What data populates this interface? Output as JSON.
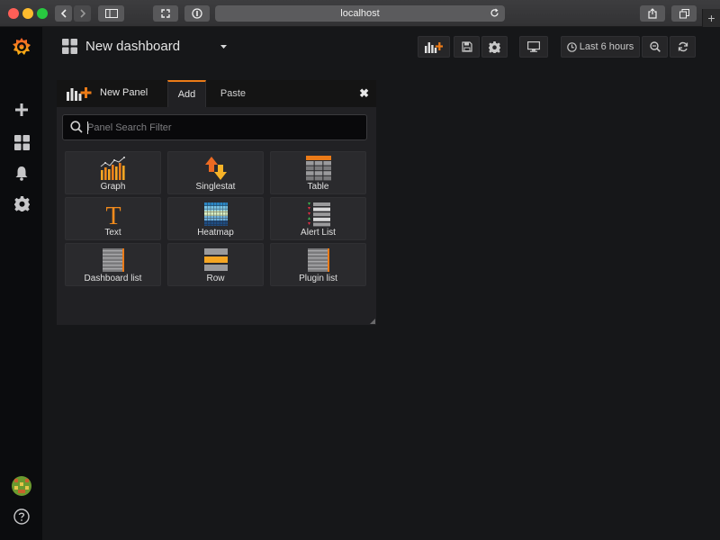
{
  "browser": {
    "url": "localhost"
  },
  "topnav": {
    "dashboard_title": "New dashboard",
    "time_range": "Last 6 hours"
  },
  "panel": {
    "title": "New Panel",
    "tabs": [
      {
        "label": "Add",
        "active": true
      },
      {
        "label": "Paste",
        "active": false
      }
    ],
    "search": {
      "placeholder": "Panel Search Filter",
      "value": ""
    },
    "items": [
      {
        "label": "Graph",
        "icon": "graph-icon"
      },
      {
        "label": "Singlestat",
        "icon": "singlestat-icon"
      },
      {
        "label": "Table",
        "icon": "table-icon"
      },
      {
        "label": "Text",
        "icon": "text-icon"
      },
      {
        "label": "Heatmap",
        "icon": "heatmap-icon"
      },
      {
        "label": "Alert List",
        "icon": "alert-list-icon"
      },
      {
        "label": "Dashboard list",
        "icon": "dashboard-list-icon"
      },
      {
        "label": "Row",
        "icon": "row-icon"
      },
      {
        "label": "Plugin list",
        "icon": "plugin-list-icon"
      }
    ]
  },
  "colors": {
    "accent": "#eb7b18",
    "background": "#161719",
    "sidebar": "#0b0c0e",
    "panel": "#212124"
  }
}
